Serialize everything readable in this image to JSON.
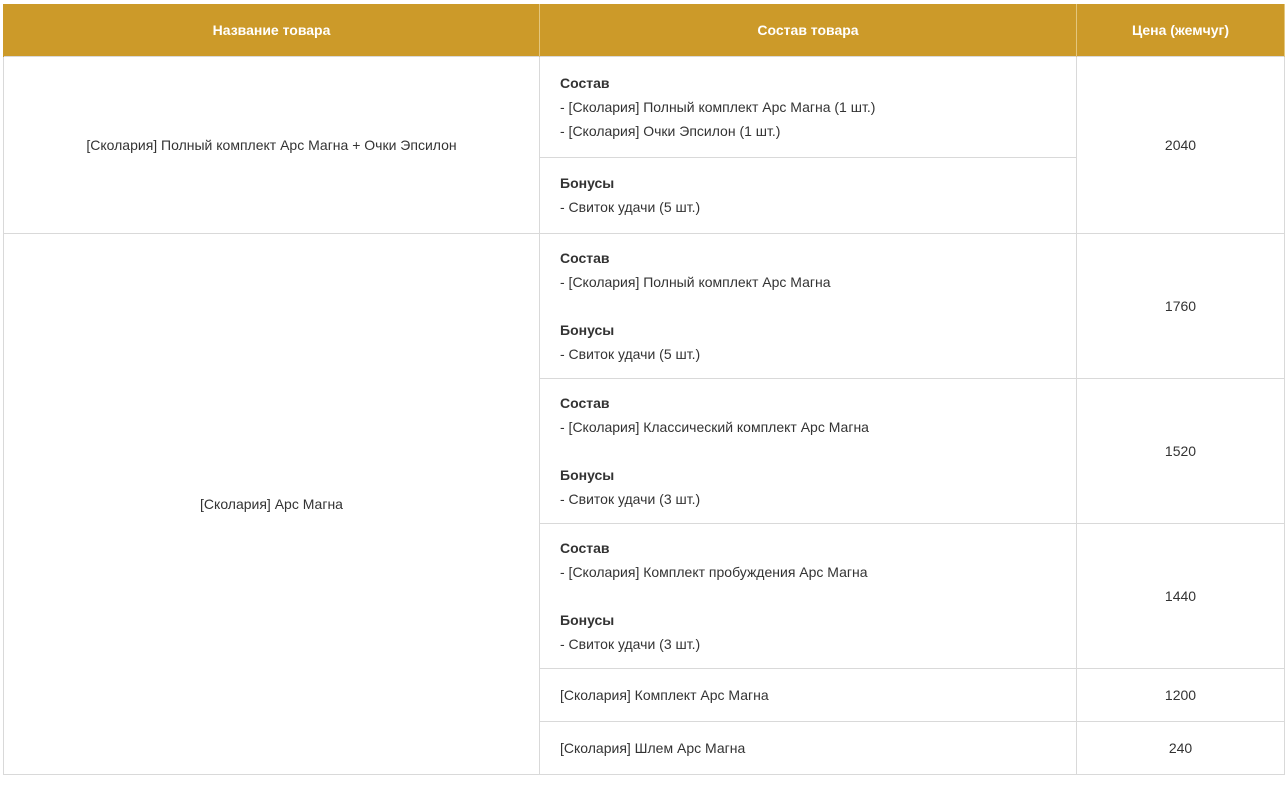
{
  "table": {
    "headers": {
      "name": "Название товара",
      "composition": "Состав товара",
      "price": "Цена (жемчуг)"
    },
    "labels": {
      "composition": "Состав",
      "bonuses": "Бонусы"
    },
    "group1": {
      "name": "[Сколария] Полный комплект Арс Магна + Очки Эпсилон",
      "price": "2040",
      "composition_items": [
        "- [Сколария] Полный комплект Арс Магна (1 шт.)",
        "- [Сколария] Очки Эпсилон (1 шт.)"
      ],
      "bonus_items": [
        "- Свиток удачи (5 шт.)"
      ]
    },
    "group2": {
      "name": "[Сколария] Арс Магна",
      "rows": [
        {
          "composition_item": "- [Сколария] Полный комплект Арс Магна",
          "bonus_item": "- Свиток удачи (5 шт.)",
          "price": "1760"
        },
        {
          "composition_item": "- [Сколария] Классический комплект Арс Магна",
          "bonus_item": "- Свиток удачи (3 шт.)",
          "price": "1520"
        },
        {
          "composition_item": "- [Сколария] Комплект пробуждения Арс Магна",
          "bonus_item": "- Свиток удачи (3 шт.)",
          "price": "1440"
        },
        {
          "simple": "[Сколария] Комплект Арс Магна",
          "price": "1200"
        },
        {
          "simple": "[Сколария] Шлем Арс Магна",
          "price": "240"
        }
      ]
    }
  }
}
